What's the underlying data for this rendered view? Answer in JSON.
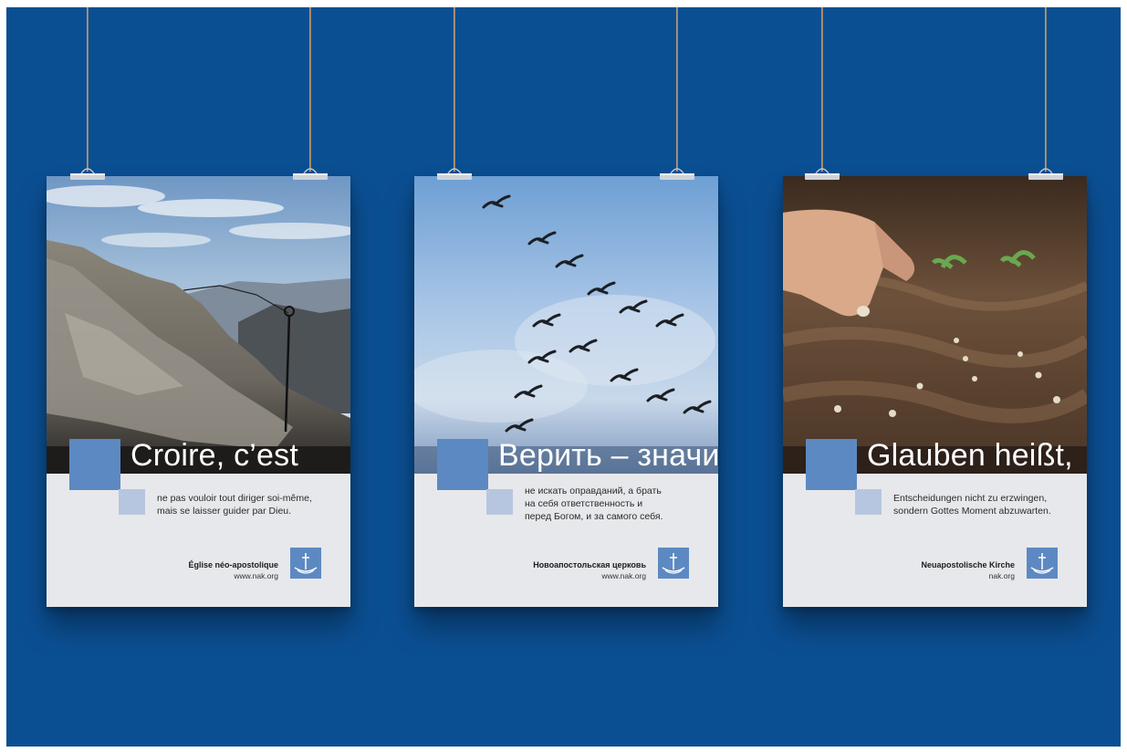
{
  "colors": {
    "background": "#0b4f93",
    "accent": "#5d89c2",
    "accent_light": "#b7c6e0",
    "poster_paper": "#e7e8eb"
  },
  "posters": [
    {
      "headline": "Croire, c’est",
      "body": "ne pas vouloir tout diriger soi-même,\nmais se laisser guider par Dieu.",
      "org": "Église néo-apostolique",
      "website": "www.nak.org",
      "photo": "mountain-ridge"
    },
    {
      "headline": "Верить – значит",
      "body": "не искать оправданий, а брать\nна себя ответственность и\nперед Богом, и за самого себя.",
      "org": "Новоапостольская церковь",
      "website": "www.nak.org",
      "photo": "flying-geese"
    },
    {
      "headline": "Glauben heißt,",
      "body": "Entscheidungen nicht zu erzwingen,\nsondern Gottes Moment abzuwarten.",
      "org": "Neuapostolische Kirche",
      "website": "nak.org",
      "photo": "planting-seeds"
    }
  ]
}
